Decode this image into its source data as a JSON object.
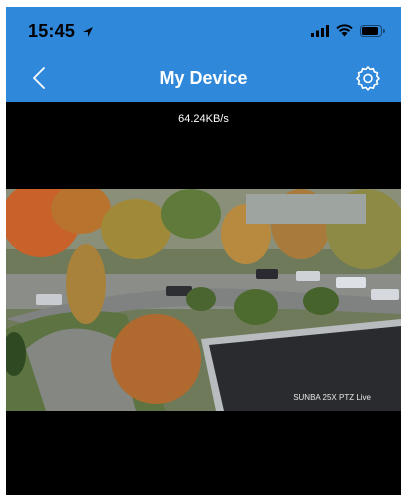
{
  "status_bar": {
    "time": "15:45",
    "icons": [
      "location-arrow-icon",
      "cellular-signal-icon",
      "wifi-icon",
      "battery-icon"
    ]
  },
  "nav": {
    "title": "My Device",
    "back_icon": "chevron-left-icon",
    "settings_icon": "settings-gear-icon"
  },
  "stream": {
    "speed": "64.24KB/s",
    "watermark": "SUNBA 25X PTZ Live"
  },
  "colors": {
    "header_blue": "#2f88da",
    "background": "#000000",
    "text": "#ffffff"
  }
}
